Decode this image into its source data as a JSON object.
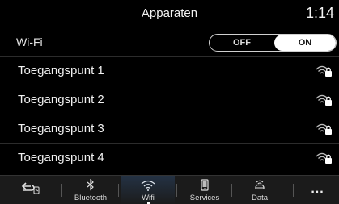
{
  "header": {
    "title": "Apparaten",
    "clock": "1:14"
  },
  "wifi": {
    "label": "Wi-Fi",
    "toggle": {
      "off_label": "OFF",
      "on_label": "ON",
      "selected": "ON"
    }
  },
  "access_points": [
    {
      "name": "Toegangspunt 1",
      "icon": "wifi-lock-icon"
    },
    {
      "name": "Toegangspunt 2",
      "icon": "wifi-lock-icon"
    },
    {
      "name": "Toegangspunt 3",
      "icon": "wifi-lock-icon"
    },
    {
      "name": "Toegangspunt 4",
      "icon": "wifi-lock-icon"
    }
  ],
  "navbar": {
    "items": [
      {
        "id": "back",
        "label": "",
        "icon": "back-arrow-icon"
      },
      {
        "id": "bluetooth",
        "label": "Bluetooth",
        "icon": "bluetooth-icon"
      },
      {
        "id": "wifi",
        "label": "Wifi",
        "icon": "wifi-icon",
        "active": true
      },
      {
        "id": "services",
        "label": "Services",
        "icon": "phone-icon"
      },
      {
        "id": "data",
        "label": "Data",
        "icon": "car-wifi-icon"
      },
      {
        "id": "more",
        "label": "...",
        "icon": "more-icon"
      }
    ]
  },
  "colors": {
    "background": "#000000",
    "navbar": "#1b1b1b",
    "active_tab": "#243244",
    "accent": "#ffffff"
  }
}
